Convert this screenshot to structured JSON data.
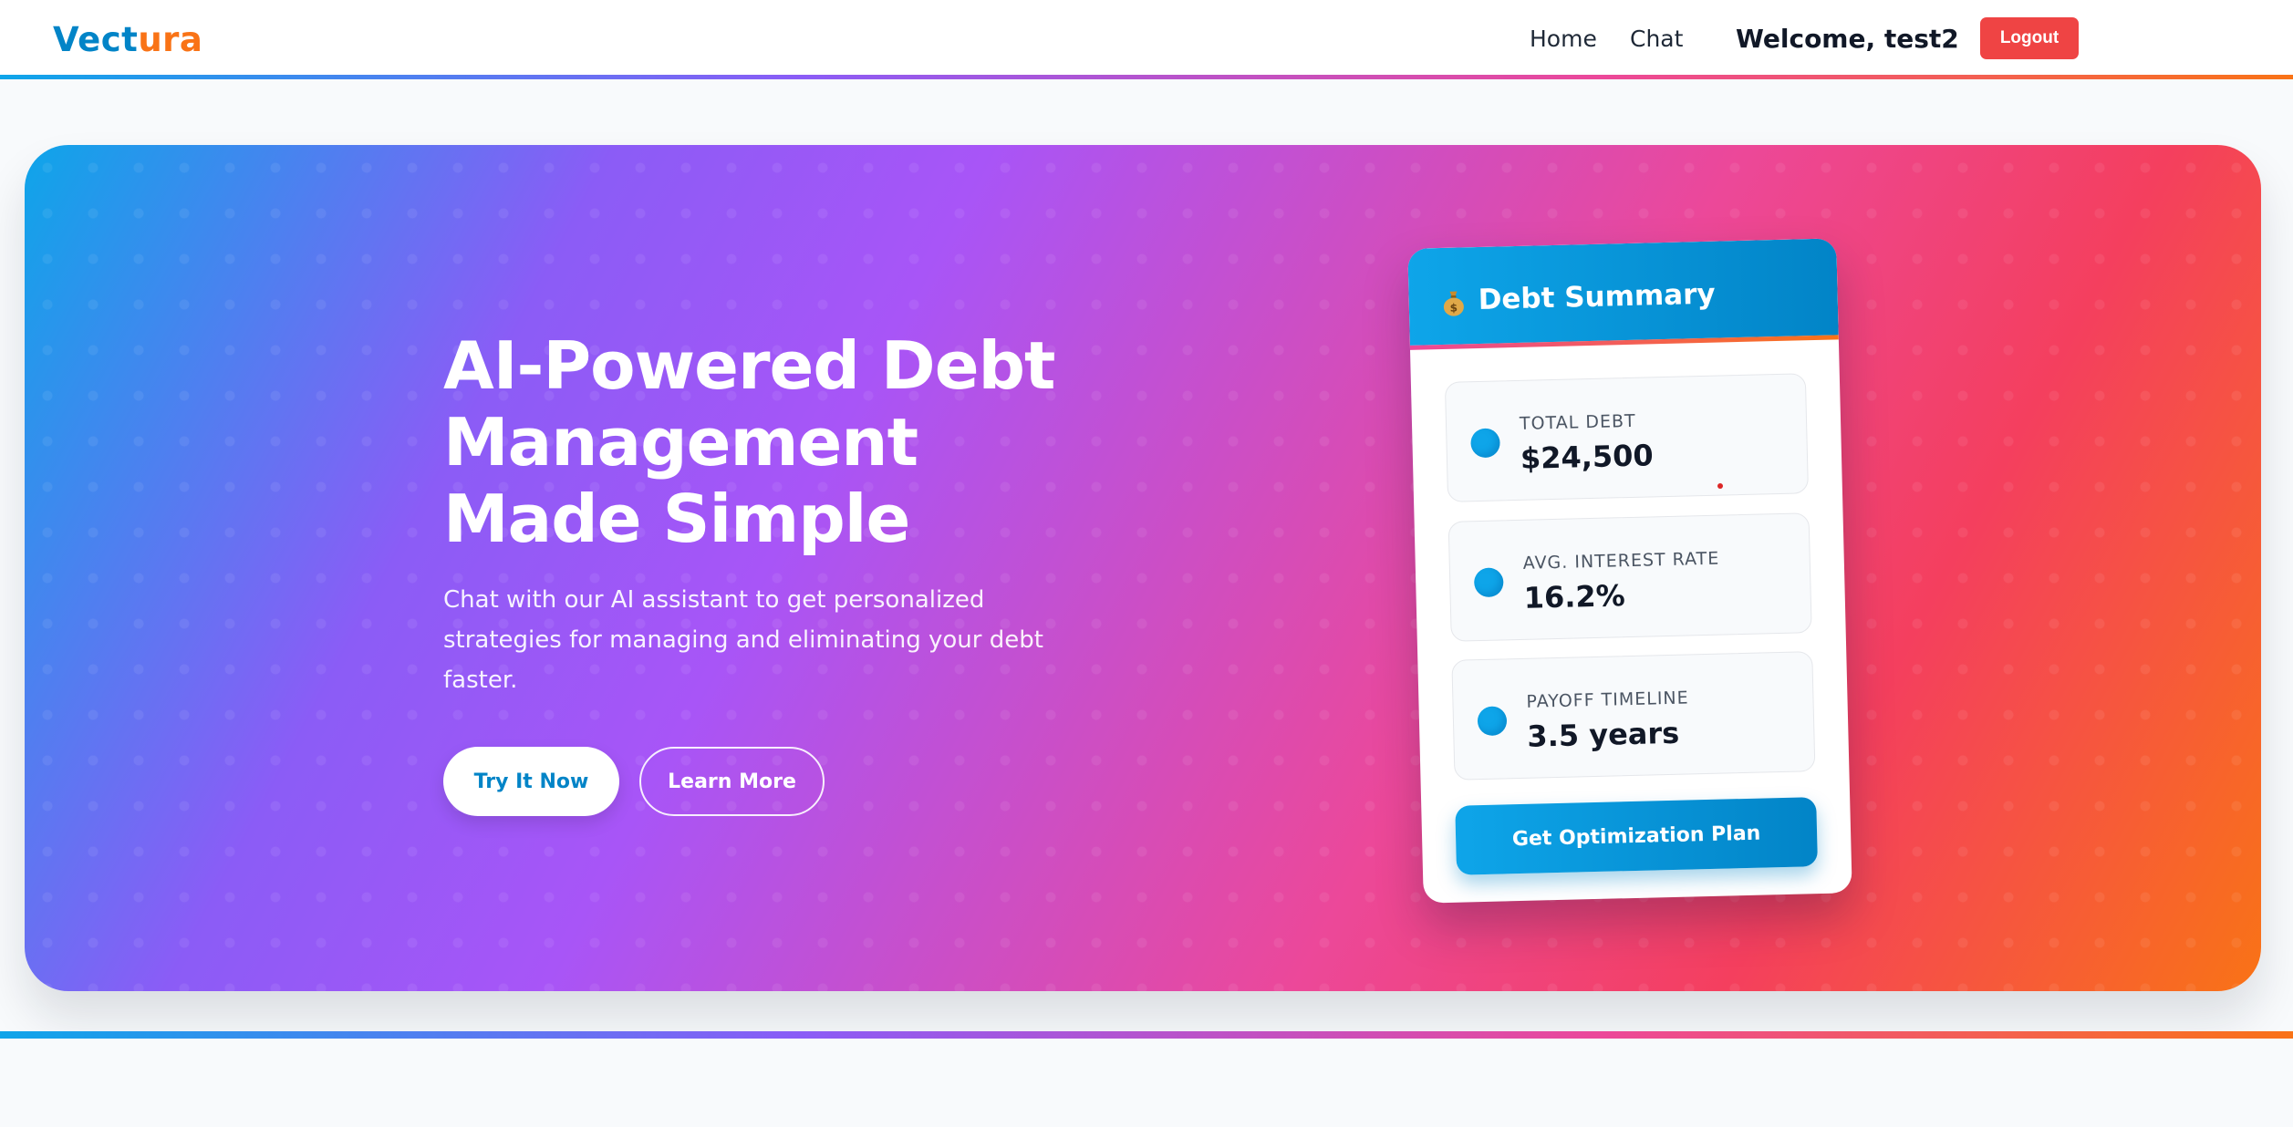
{
  "brand": {
    "part1": "Vect",
    "part2": "ura"
  },
  "nav": {
    "home": "Home",
    "chat": "Chat",
    "welcome": "Welcome, test2",
    "logout": "Logout"
  },
  "hero": {
    "title": "AI-Powered Debt Management Made Simple",
    "subtitle": "Chat with our AI assistant to get personalized strategies for managing and eliminating your debt faster.",
    "primary_button": "Try It Now",
    "secondary_button": "Learn More"
  },
  "card": {
    "icon": "money-bag-icon",
    "title": "Debt Summary",
    "stats": [
      {
        "label": "TOTAL DEBT",
        "value": "$24,500"
      },
      {
        "label": "AVG. INTEREST RATE",
        "value": "16.2%"
      },
      {
        "label": "PAYOFF TIMELINE",
        "value": "3.5 years"
      }
    ],
    "cta": "Get Optimization Plan"
  },
  "colors": {
    "primary": "#0284c7",
    "accent": "#f97316",
    "logout": "#ef4444",
    "gradient": [
      "#0ea5e9",
      "#8b5cf6",
      "#a855f7",
      "#ec4899",
      "#f97316"
    ]
  }
}
